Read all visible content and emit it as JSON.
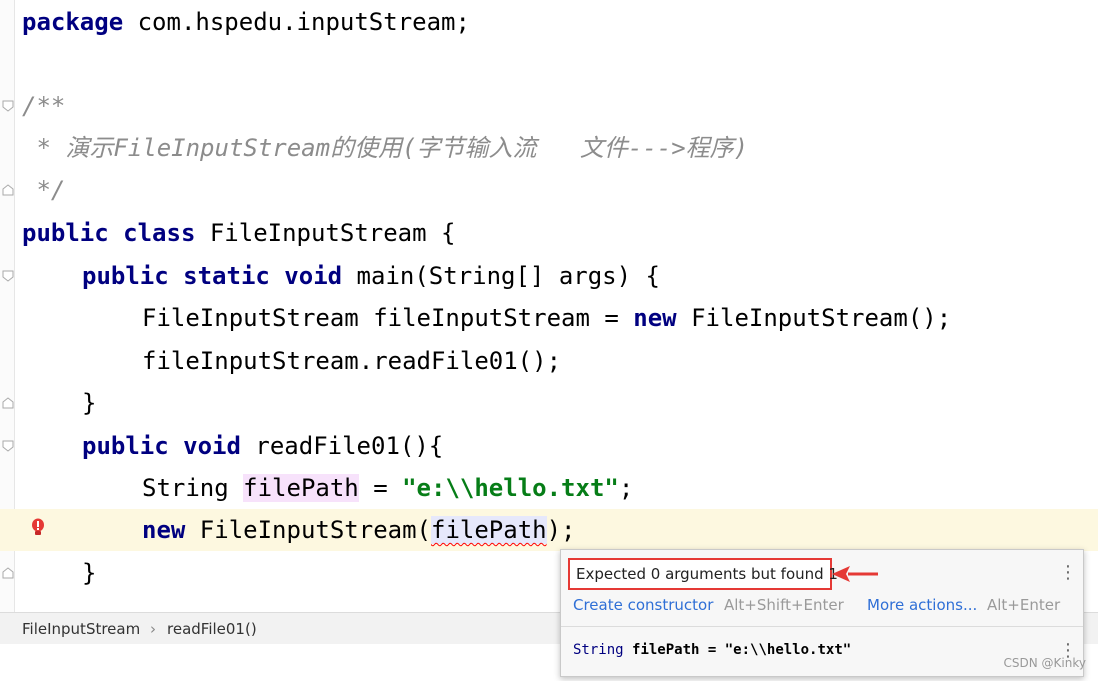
{
  "code": {
    "line1": {
      "kw": "package",
      "rest": " com.hspedu.inputStream;"
    },
    "line4": "/**",
    "line5": " * 演示FileInputStream的使用(字节输入流   文件--->程序)",
    "line6": " */",
    "line7": {
      "kw": "public class",
      "rest": " FileInputStream {"
    },
    "line8": {
      "kw": "public static void",
      "rest": " main(String[] args) {"
    },
    "line9": {
      "type": "FileInputStream fileInputStream = ",
      "kw": "new",
      "rest": " FileInputStream();"
    },
    "line10": "fileInputStream.readFile01();",
    "line11": "}",
    "line12": {
      "kw": "public void",
      "rest": " readFile01(){"
    },
    "line13": {
      "type": "String ",
      "var": "filePath",
      "eq": " = ",
      "str": "\"e:\\\\hello.txt\"",
      "end": ";"
    },
    "line14": {
      "kw": "new",
      "mid": " FileInputStream(",
      "arg": "filePath",
      "end": ");"
    },
    "line15": "}"
  },
  "breadcrumb": {
    "class": "FileInputStream",
    "separator": "›",
    "method": "readFile01()"
  },
  "popup": {
    "error_message": "Expected 0 arguments but found 1",
    "action1": {
      "label": "Create constructor",
      "shortcut": "Alt+Shift+Enter"
    },
    "action2": {
      "label": "More actions...",
      "shortcut": "Alt+Enter"
    },
    "declaration": {
      "type": "String",
      "name": "filePath",
      "value": "= \"e:\\\\hello.txt\""
    }
  },
  "icons": [
    "fold-marker-icon",
    "error-bulb-icon",
    "kebab-menu-icon",
    "red-arrow-icon"
  ],
  "colors": {
    "keyword": "#000080",
    "string": "#067d17",
    "error": "#e53935",
    "link": "#2f6fd6"
  },
  "watermark": "CSDN @Kinky"
}
